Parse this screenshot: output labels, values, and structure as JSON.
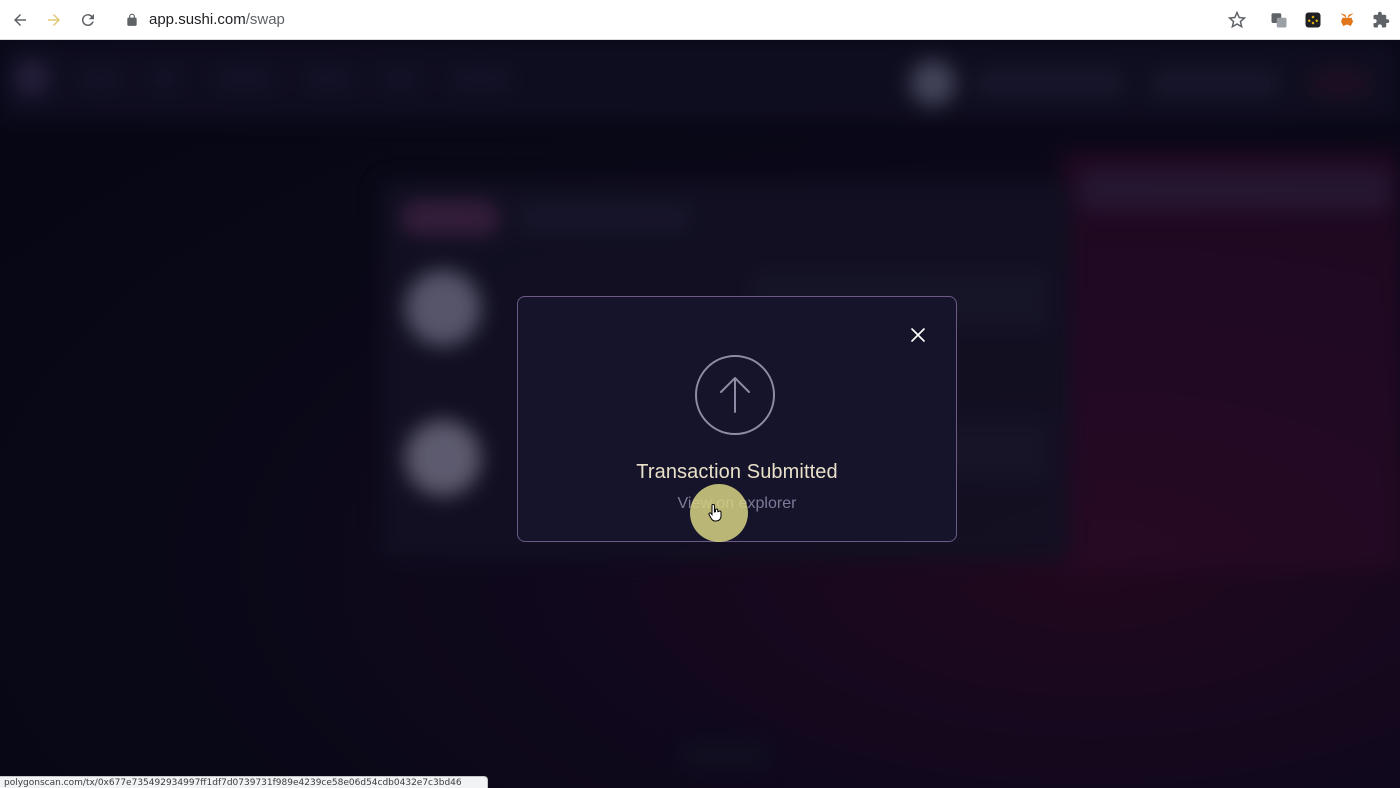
{
  "browser": {
    "url_host": "app.sushi.com",
    "url_path": "/swap"
  },
  "modal": {
    "title": "Transaction Submitted",
    "link_text": "View on explorer"
  },
  "status_bar": {
    "text": "polygonscan.com/tx/0x677e735492934997ff1df7d0739731f989e4239ce58e06d54cdb0432e7c3bd46"
  },
  "colors": {
    "modal_title": "#e8e0c8",
    "modal_border": "#6b5a86",
    "click_indicator": "#d7d282"
  }
}
